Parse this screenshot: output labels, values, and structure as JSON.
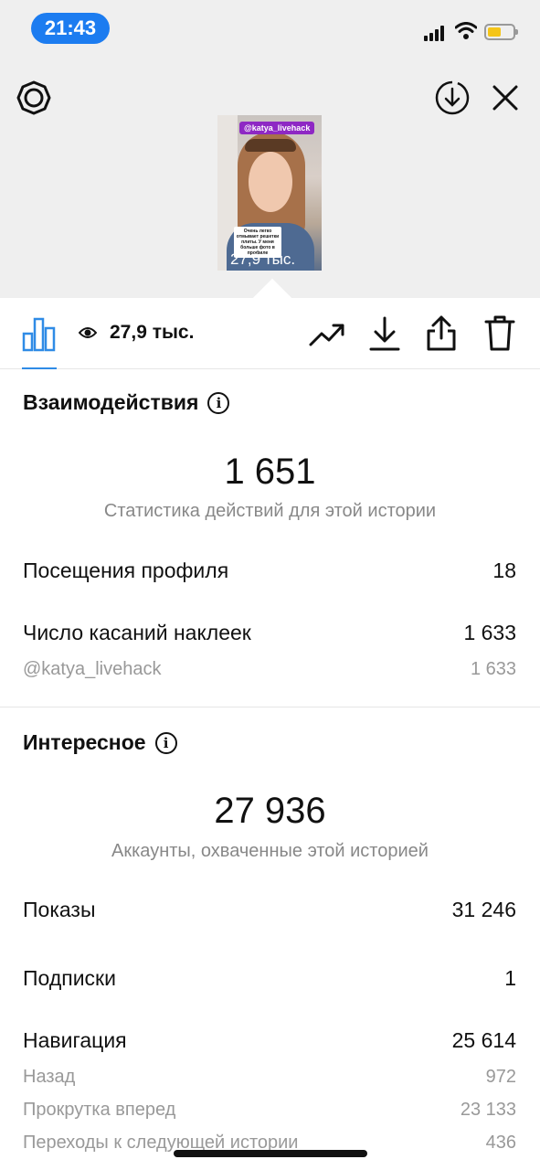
{
  "status_bar": {
    "time": "21:43"
  },
  "story": {
    "mention_tag": "@katya_livehack",
    "caption_text": "Очень легко отмывает решетки плиты. У меня больше фото в профиле",
    "views_overlay": "27,9 тыс."
  },
  "toolbar": {
    "views": "27,9 тыс."
  },
  "interactions": {
    "title": "Взаимодействия",
    "total": "1 651",
    "subtitle": "Статистика действий для этой истории",
    "rows": [
      {
        "label": "Посещения профиля",
        "value": "18"
      },
      {
        "label": "Число касаний наклеек",
        "value": "1 633"
      },
      {
        "label": "@katya_livehack",
        "value": "1 633"
      }
    ]
  },
  "discovery": {
    "title": "Интересное",
    "total": "27 936",
    "subtitle": "Аккаунты, охваченные этой историей",
    "rows": [
      {
        "label": "Показы",
        "value": "31 246"
      },
      {
        "label": "Подписки",
        "value": "1"
      },
      {
        "label": "Навигация",
        "value": "25 614"
      },
      {
        "label": "Назад",
        "value": "972"
      },
      {
        "label": "Прокрутка вперед",
        "value": "23 133"
      },
      {
        "label": "Переходы к следующей истории",
        "value": "436"
      }
    ]
  },
  "colors": {
    "accent": "#2f8be6",
    "time_pill": "#1c7cf0",
    "tag": "#8e28c4"
  }
}
